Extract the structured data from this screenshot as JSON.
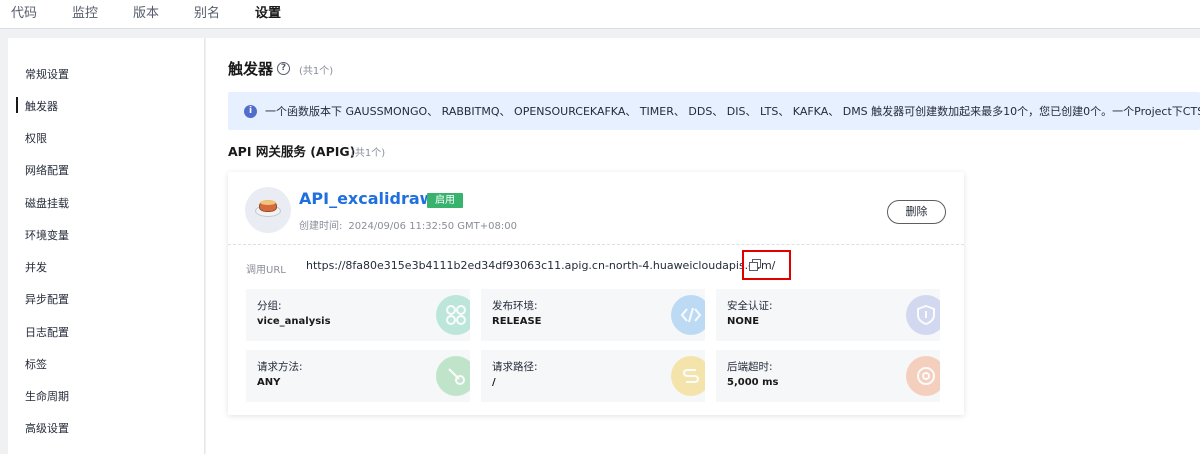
{
  "top_tabs": [
    "代码",
    "监控",
    "版本",
    "别名",
    "设置"
  ],
  "sidebar": {
    "items": [
      "常规设置",
      "触发器",
      "权限",
      "网络配置",
      "磁盘挂载",
      "环境变量",
      "并发",
      "异步配置",
      "日志配置",
      "标签",
      "生命周期",
      "高级设置"
    ],
    "active": "触发器"
  },
  "main": {
    "title": "触发器",
    "title_count": "(共1个)",
    "info_text": "一个函数版本下 GAUSSMONGO、 RABBITMQ、 OPENSOURCEKAFKA、 TIMER、 DDS、 DIS、 LTS、 KAFKA、 DMS 触发器可创建数加起来最多10个，您已创建0个。一个Project下CTS触发器",
    "section_title": "API 网关服务 (APIG)",
    "section_count": "(共1个)"
  },
  "card": {
    "name": "API_excalidraw",
    "status": "启用",
    "created_label": "创建时间:",
    "created_value": "2024/09/06 11:32:50 GMT+08:00",
    "delete_label": "删除",
    "url_label": "调用URL",
    "url_value": "https://8fa80e315e3b4111b2ed34df93063c11.apig.cn-north-4.huaweicloudapis.com/",
    "fields": [
      {
        "label": "分组:",
        "value": "vice_analysis",
        "icon": "group-icon",
        "color": "#8fd9c4"
      },
      {
        "label": "发布环境:",
        "value": "RELEASE",
        "icon": "code-icon",
        "color": "#8ec3f0"
      },
      {
        "label": "安全认证:",
        "value": "NONE",
        "icon": "shield-icon",
        "color": "#b6bfe8"
      },
      {
        "label": "请求方法:",
        "value": "ANY",
        "icon": "method-icon",
        "color": "#95d6a4"
      },
      {
        "label": "请求路径:",
        "value": "/",
        "icon": "path-icon",
        "color": "#f5d36e"
      },
      {
        "label": "后端超时:",
        "value": "5,000 ms",
        "icon": "timeout-icon",
        "color": "#f5b08e"
      }
    ]
  },
  "colors": {
    "link": "#1f6fe0",
    "status_badge": "#37b36e",
    "info_bg": "#e6f0fe",
    "highlight": "#e00000"
  }
}
